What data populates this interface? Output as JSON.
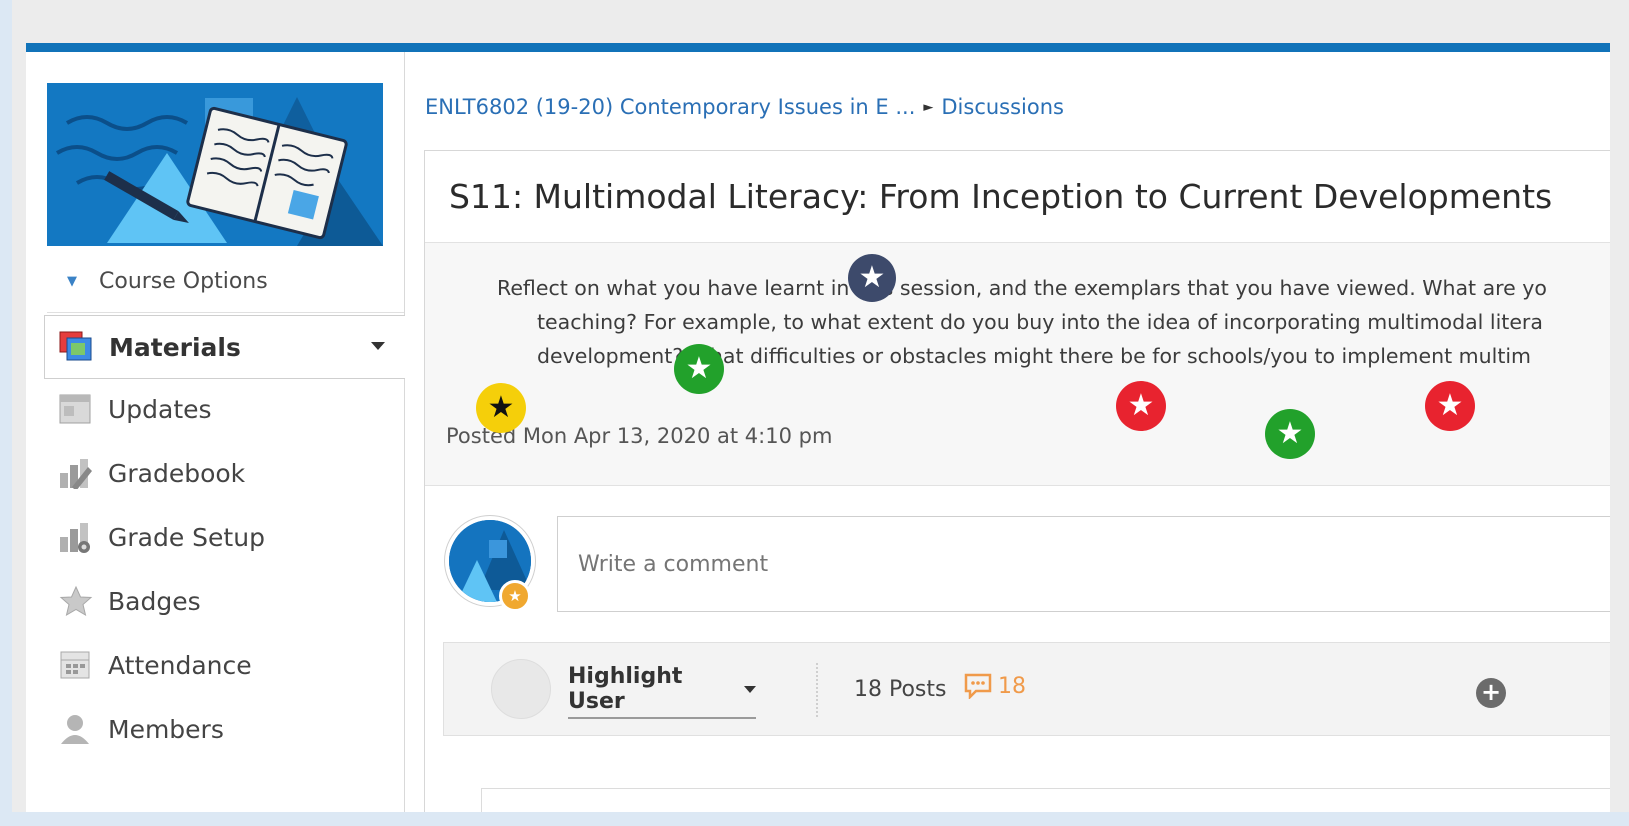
{
  "sidebar": {
    "course_options_label": "Course Options",
    "items": [
      {
        "label": "Materials",
        "icon": "materials-icon",
        "active": true
      },
      {
        "label": "Updates",
        "icon": "updates-icon"
      },
      {
        "label": "Gradebook",
        "icon": "gradebook-icon"
      },
      {
        "label": "Grade Setup",
        "icon": "grade-setup-icon"
      },
      {
        "label": "Badges",
        "icon": "badges-icon"
      },
      {
        "label": "Attendance",
        "icon": "attendance-icon"
      },
      {
        "label": "Members",
        "icon": "members-icon"
      }
    ]
  },
  "breadcrumb": {
    "course": "ENLT6802 (19-20) Contemporary Issues in E ...",
    "separator": "►",
    "current": "Discussions"
  },
  "discussion": {
    "title": "S11: Multimodal Literacy: From Inception to Current Developments",
    "prompt_line1": "Reflect on what you have learnt in this session, and the exemplars that you have viewed. What are yo",
    "prompt_line2": "teaching? For example, to what extent do you buy into the idea of incorporating multimodal litera",
    "prompt_line3": "development? What difficulties or obstacles might there be for schools/you to implement multim",
    "posted": "Posted Mon Apr 13, 2020 at 4:10 pm"
  },
  "comment": {
    "placeholder": "Write a comment"
  },
  "filter": {
    "highlight_user_label": "Highlight User",
    "posts_label": "18 Posts",
    "comments_count": "18"
  },
  "markers": [
    {
      "color": "#3d4a6b",
      "glyph": "★",
      "name": "navy-star-marker"
    },
    {
      "color": "#22a12b",
      "glyph": "★",
      "name": "green-star-marker"
    },
    {
      "color": "#f5cf0a",
      "glyph": "★",
      "name": "yellow-star-marker"
    },
    {
      "color": "#e8232f",
      "glyph": "★",
      "name": "red-star-marker"
    },
    {
      "color": "#22a12b",
      "glyph": "★",
      "name": "green-star-marker"
    },
    {
      "color": "#e8232f",
      "glyph": "★",
      "name": "red-star-marker"
    }
  ],
  "colors": {
    "accent": "#1173b9",
    "link": "#2a6fb5",
    "comments_accent": "#f09a4a"
  }
}
